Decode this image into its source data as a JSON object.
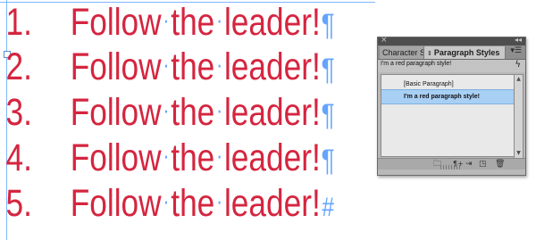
{
  "document": {
    "paragraphs": [
      {
        "number": "1.",
        "w1": "Follow",
        "w2": "the",
        "w3": "leader!",
        "end_mark": "¶"
      },
      {
        "number": "2.",
        "w1": "Follow",
        "w2": "the",
        "w3": "leader!",
        "end_mark": "¶"
      },
      {
        "number": "3.",
        "w1": "Follow",
        "w2": "the",
        "w3": "leader!",
        "end_mark": "¶"
      },
      {
        "number": "4.",
        "w1": "Follow",
        "w2": "the",
        "w3": "leader!",
        "end_mark": "¶"
      },
      {
        "number": "5.",
        "w1": "Follow",
        "w2": "the",
        "w3": "leader!",
        "end_mark": "#"
      }
    ],
    "space_marker": "·",
    "text_color": "#d5253f",
    "invisibles_color": "#63a4ff"
  },
  "panel": {
    "titlebar": {
      "close_icon": "×",
      "collapse_icon": "◂◂"
    },
    "tabs": [
      {
        "label": "Character S",
        "active": false
      },
      {
        "label": "Paragraph Styles",
        "active": true,
        "icon": "double-arrow-icon"
      }
    ],
    "tab_arrows": "⇕",
    "menu_icon": "▾☰",
    "current_style": "I'm a red paragraph style!",
    "lightning_icon": "ϟ",
    "styles": [
      {
        "label": "[Basic Paragraph]",
        "selected": false
      },
      {
        "label": "I'm a red paragraph style!",
        "selected": true
      }
    ],
    "footer_icons": {
      "folder": "🗀",
      "clear": "¶+",
      "redefine": "⇥",
      "new": "◳",
      "trash": "🗑"
    },
    "scroll_up": "▲",
    "scroll_down": "▼"
  }
}
